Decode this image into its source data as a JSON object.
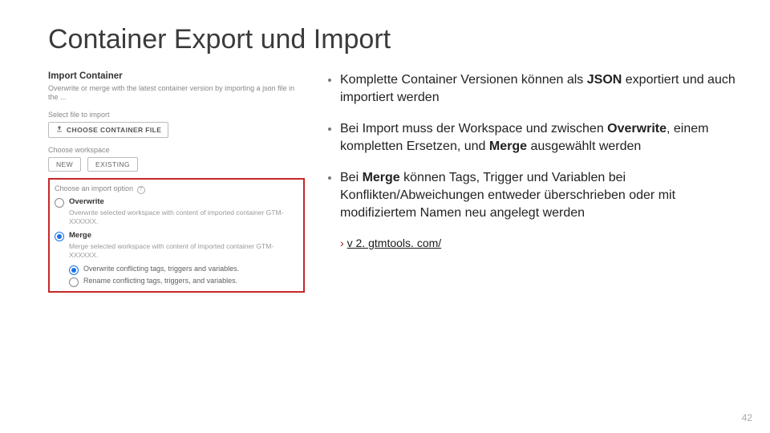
{
  "slide": {
    "title": "Container Export und Import",
    "page_number": "42"
  },
  "left_panel": {
    "heading": "Import Container",
    "description": "Overwrite or merge with the latest container version by importing a json file in the ...",
    "select_file_label": "Select file to import",
    "choose_button": "CHOOSE CONTAINER FILE",
    "workspace_label": "Choose workspace",
    "workspace_new": "NEW",
    "workspace_existing": "EXISTING",
    "import_option_label": "Choose an import option",
    "opt_overwrite": {
      "label": "Overwrite",
      "desc": "Overwrite selected workspace with content of imported container GTM-XXXXXX."
    },
    "opt_merge": {
      "label": "Merge",
      "desc": "Merge selected workspace with content of imported container GTM-XXXXXX.",
      "sub_overwrite": "Overwrite conflicting tags, triggers and variables.",
      "sub_rename": "Rename conflicting tags, triggers, and variables."
    }
  },
  "bullets": {
    "b1_a": "Komplette Container Versionen können als ",
    "b1_strong": "JSON",
    "b1_b": " exportiert und auch importiert werden",
    "b2_a": "Bei Import muss der Workspace und zwischen ",
    "b2_s1": "Overwrite",
    "b2_b": ", einem kompletten Ersetzen, und ",
    "b2_s2": "Merge",
    "b2_c": " ausgewählt werden",
    "b3_a": "Bei ",
    "b3_s1": "Merge",
    "b3_b": " können Tags, Trigger und Variablen bei Konflikten/Abweichungen entweder überschrieben oder mit modifiziertem Namen neu angelegt werden"
  },
  "link": {
    "chev": "›",
    "text": "v 2. gtmtools. com/"
  },
  "icons": {
    "upload_label": "upload-icon",
    "help_char": "?"
  }
}
